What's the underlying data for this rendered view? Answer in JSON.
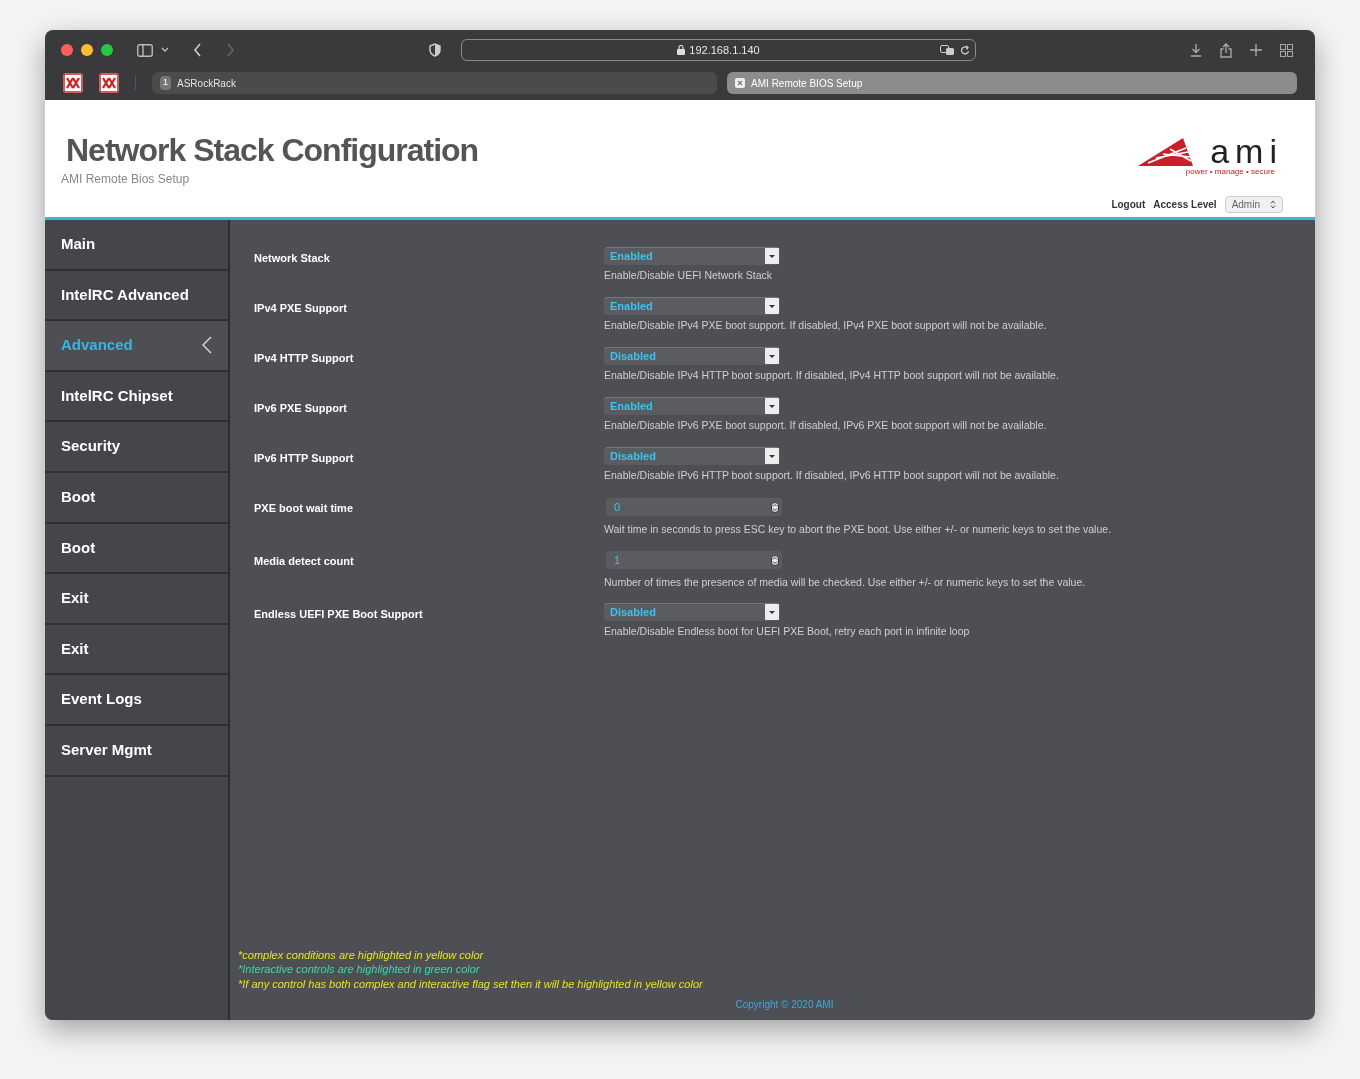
{
  "browser": {
    "url": "192.168.1.140",
    "tabs": [
      {
        "badge": "1",
        "label": "ASRockRack",
        "selected": false
      },
      {
        "label": "AMI Remote BIOS Setup",
        "selected": true
      }
    ]
  },
  "header": {
    "title": "Network Stack Configuration",
    "subtitle": "AMI Remote Bios Setup",
    "logo_text": "ami",
    "logo_tagline": "power • manage • secure",
    "logout": "Logout",
    "access_level_label": "Access Level",
    "access_level_value": "Admin"
  },
  "sidebar": {
    "items": [
      {
        "label": "Main",
        "selected": false
      },
      {
        "label": "IntelRC Advanced",
        "selected": false
      },
      {
        "label": "Advanced",
        "selected": true
      },
      {
        "label": "IntelRC Chipset",
        "selected": false
      },
      {
        "label": "Security",
        "selected": false
      },
      {
        "label": "Boot",
        "selected": false
      },
      {
        "label": "Boot",
        "selected": false
      },
      {
        "label": "Exit",
        "selected": false
      },
      {
        "label": "Exit",
        "selected": false
      },
      {
        "label": "Event Logs",
        "selected": false
      },
      {
        "label": "Server Mgmt",
        "selected": false
      }
    ]
  },
  "settings": [
    {
      "kind": "select",
      "label": "Network Stack",
      "value": "Enabled",
      "help": "Enable/Disable UEFI Network Stack"
    },
    {
      "kind": "select",
      "label": "IPv4 PXE Support",
      "value": "Enabled",
      "help": "Enable/Disable IPv4 PXE boot support. If disabled, IPv4 PXE boot support will not be available."
    },
    {
      "kind": "select",
      "label": "IPv4 HTTP Support",
      "value": "Disabled",
      "help": "Enable/Disable IPv4 HTTP boot support. If disabled, IPv4 HTTP boot support will not be available."
    },
    {
      "kind": "select",
      "label": "IPv6 PXE Support",
      "value": "Enabled",
      "help": "Enable/Disable IPv6 PXE boot support. If disabled, IPv6 PXE boot support will not be available."
    },
    {
      "kind": "select",
      "label": "IPv6 HTTP Support",
      "value": "Disabled",
      "help": "Enable/Disable IPv6 HTTP boot support. If disabled, IPv6 HTTP boot support will not be available."
    },
    {
      "kind": "number",
      "label": "PXE boot wait time",
      "value": "0",
      "help": "Wait time in seconds to press ESC key to abort the PXE boot. Use either +/- or numeric keys to set the value."
    },
    {
      "kind": "number",
      "label": "Media detect count",
      "value": "1",
      "help": "Number of times the presence of media will be checked. Use either +/- or numeric keys to set the value."
    },
    {
      "kind": "select",
      "label": "Endless UEFI PXE Boot Support",
      "value": "Disabled",
      "help": "Enable/Disable Endless boot for UEFI PXE Boot, retry each port in infinite loop"
    }
  ],
  "notes": [
    {
      "text": "*complex conditions are highlighted in yellow color",
      "color": "#e6e619"
    },
    {
      "text": "*Interactive controls are highlighted in green color",
      "color": "#3fd6a6"
    },
    {
      "text": "*If any control has both complex and interactive flag set then it will be highlighted in yellow color",
      "color": "#e6e619"
    }
  ],
  "copyright": "Copyright © 2020 AMI"
}
